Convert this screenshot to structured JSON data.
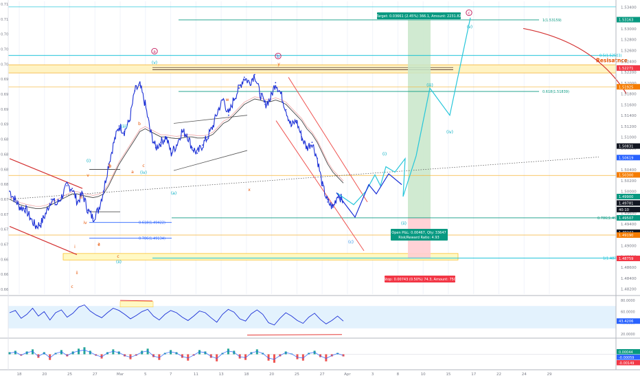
{
  "chart_data": {
    "type": "line",
    "instrument_note": "",
    "price_axis": {
      "ticks": [
        "1.53400",
        "1.53163",
        "1.53000",
        "1.52800",
        "1.52600",
        "1.52400",
        "1.52271",
        "1.52200",
        "1.52000",
        "1.51800",
        "1.51600",
        "1.51400",
        "1.51200",
        "1.51000",
        "1.50800",
        "1.50619",
        "1.50400",
        "1.50200",
        "1.50000",
        "1.49800",
        "1.49600",
        "1.49400",
        "1.49200",
        "1.49000",
        "1.48800",
        "1.48600",
        "1.48400",
        "1.48200",
        "1.48000",
        "1.47800"
      ],
      "ylim": [
        1.481,
        1.535
      ],
      "badges": [
        {
          "label": "1.53163",
          "value": 1.53163,
          "color": "#089981"
        },
        {
          "label": "1.52271",
          "value": 1.52271,
          "color": "#f23645"
        },
        {
          "label": "1.51925",
          "value": 1.51925,
          "color": "#f57c00"
        },
        {
          "label": "1.50831",
          "value": 1.50831,
          "color": "#131722"
        },
        {
          "label": "1.50619",
          "value": 1.50619,
          "color": "#2962ff"
        },
        {
          "label": "1.50300",
          "value": 1.503,
          "color": "#f57c00"
        },
        {
          "label": "1.49900",
          "value": 1.499,
          "color": "#089981"
        },
        {
          "label": "1.49781",
          "value": 1.49781,
          "color": "#131722"
        },
        {
          "label": "40:10",
          "value": 1.4966,
          "color": "#131722"
        },
        {
          "label": "1.49507",
          "value": 1.49507,
          "color": "#089981"
        },
        {
          "label": "1.49242",
          "value": 1.49242,
          "color": "#131722"
        },
        {
          "label": "1.49190",
          "value": 1.4919,
          "color": "#f57c00"
        },
        {
          "label": "1.48759",
          "value": 1.48759,
          "color": "#f23645"
        }
      ]
    },
    "left_axis_ticks": [
      "0.71",
      "0.71",
      "0.70",
      "0.70",
      "0.70",
      "0.69",
      "0.69",
      "0.69",
      "0.69",
      "0.68",
      "0.68",
      "0.68",
      "0.68",
      "0.67",
      "0.67",
      "0.67",
      "0.67",
      "0.66",
      "0.66",
      "0.66"
    ],
    "time_axis": [
      "18",
      "20",
      "25",
      "27",
      "Mar",
      "5",
      "7",
      "11",
      "13",
      "18",
      "20",
      "25",
      "27",
      "Apr",
      "3",
      "8",
      "10",
      "15",
      "17",
      "22",
      "24",
      "29"
    ],
    "price_series": [
      1.5,
      1.4985,
      1.497,
      1.4968,
      1.495,
      1.4935,
      1.494,
      1.496,
      1.4985,
      1.4975,
      1.499,
      1.501,
      1.5005,
      1.498,
      1.4995,
      1.4965,
      1.495,
      1.4965,
      1.5,
      1.505,
      1.509,
      1.512,
      1.511,
      1.513,
      1.5185,
      1.5195,
      1.516,
      1.511,
      1.508,
      1.509,
      1.51,
      1.507,
      1.5085,
      1.511,
      1.5105,
      1.508,
      1.507,
      1.5085,
      1.51,
      1.512,
      1.515,
      1.517,
      1.514,
      1.517,
      1.519,
      1.521,
      1.52,
      1.5215,
      1.518,
      1.516,
      1.517,
      1.52,
      1.518,
      1.515,
      1.512,
      1.513,
      1.51,
      1.508,
      1.509,
      1.506,
      1.501,
      1.498,
      1.497,
      1.4995,
      1.498
    ],
    "moving_average": [
      1.4985,
      1.498,
      1.4975,
      1.4972,
      1.497,
      1.4968,
      1.4968,
      1.497,
      1.4975,
      1.498,
      1.4985,
      1.499,
      1.4995,
      1.4995,
      1.4992,
      1.499,
      1.4988,
      1.499,
      1.4995,
      1.501,
      1.503,
      1.505,
      1.5065,
      1.508,
      1.5095,
      1.511,
      1.5115,
      1.511,
      1.5105,
      1.51,
      1.51,
      1.5098,
      1.5097,
      1.5098,
      1.51,
      1.51,
      1.5098,
      1.5098,
      1.51,
      1.5105,
      1.5115,
      1.5125,
      1.513,
      1.514,
      1.515,
      1.516,
      1.5165,
      1.517,
      1.5168,
      1.5165,
      1.5165,
      1.5168,
      1.5165,
      1.516,
      1.515,
      1.514,
      1.513,
      1.5115,
      1.5105,
      1.509,
      1.507,
      1.505,
      1.5035,
      1.5025,
      1.5015
    ],
    "projection_path": [
      1.4997,
      1.4975,
      1.5,
      1.503,
      1.501,
      1.5045,
      1.5035,
      1.506,
      1.499,
      1.5065,
      1.519,
      1.514,
      1.532
    ],
    "horizontal_levels": [
      {
        "label": "1(1.53159)",
        "value": 1.53159,
        "color": "#089981"
      },
      {
        "label": "0.5(1.52503)",
        "value": 1.52503,
        "color": "#00bcd4"
      },
      {
        "label": "0.618(1.51839)",
        "value": 1.51839,
        "color": "#089981"
      },
      {
        "label": "0.786(1.49508)",
        "value": 1.49508,
        "color": "#089981"
      },
      {
        "label": "1(1.48765)",
        "value": 1.48765,
        "color": "#00bcd4"
      },
      {
        "label": "0.618(1.49422)",
        "value": 1.49422,
        "color": "#2962ff"
      },
      {
        "label": "0.786(1.49134)",
        "value": 1.49134,
        "color": "#2962ff"
      }
    ],
    "resistance_label": "Resisatnce",
    "target_box": "Target: 0.03661 (2.45%) 366.1, Amount: 2231.82",
    "stop_box": "Stop: 0.00743 (0.50%) 74.3, Amount: 750",
    "open_pnl_line1": "Open P&L: 0.00467, Qty: 33647",
    "open_pnl_line2": "Risk/Reward Ratio: 4.93",
    "wave_labels": [
      {
        "text": "a",
        "color": "#c2185b",
        "circled": true
      },
      {
        "text": "b",
        "color": "#c2185b",
        "circled": true
      },
      {
        "text": "c",
        "color": "#c2185b",
        "circled": true
      },
      {
        "text": "b",
        "color": "#1e88e5",
        "circled": false,
        "paren": true
      },
      {
        "text": "(v)",
        "color": "#00acc1"
      },
      {
        "text": "(i)",
        "color": "#00acc1"
      },
      {
        "text": "(ii)",
        "color": "#00acc1"
      },
      {
        "text": "(iii)",
        "color": "#00acc1"
      },
      {
        "text": "(iv)",
        "color": "#00acc1"
      },
      {
        "text": "(a)",
        "color": "#00acc1"
      },
      {
        "text": "(c)",
        "color": "#1e88e5"
      },
      {
        "text": "(i)",
        "color": "#00acc1"
      },
      {
        "text": "(ii)",
        "color": "#00acc1"
      },
      {
        "text": "(iii)",
        "color": "#00acc1"
      },
      {
        "text": "(iv)",
        "color": "#00acc1"
      },
      {
        "text": "(v)",
        "color": "#00acc1"
      },
      {
        "text": "w",
        "color": "#e65100"
      },
      {
        "text": "x",
        "color": "#e65100"
      },
      {
        "text": "y",
        "color": "#e65100"
      },
      {
        "text": "b",
        "color": "#e65100"
      },
      {
        "text": "c",
        "color": "#e65100"
      },
      {
        "text": "a",
        "color": "#e65100"
      },
      {
        "text": "b",
        "color": "#e65100"
      },
      {
        "text": "c",
        "color": "#e65100"
      },
      {
        "text": "i",
        "color": "#e65100"
      },
      {
        "text": "ii",
        "color": "#e65100"
      },
      {
        "text": "iii",
        "color": "#e65100"
      },
      {
        "text": "iv",
        "color": "#e65100"
      },
      {
        "text": "v",
        "color": "#e65100"
      },
      {
        "text": "a",
        "color": "#e65100"
      },
      {
        "text": "b",
        "color": "#e65100"
      },
      {
        "text": "c",
        "color": "#e65100"
      },
      {
        "text": "c",
        "color": "#e65100"
      }
    ],
    "oscillator1": {
      "ticks": [
        "80.0000",
        "60.0000",
        "40.0000",
        "20.0000"
      ],
      "value_label": "43.4206",
      "ylim": [
        15,
        85
      ],
      "band": [
        30,
        70
      ],
      "values": [
        58,
        62,
        48,
        55,
        66,
        52,
        60,
        45,
        58,
        63,
        50,
        57,
        68,
        72,
        61,
        54,
        49,
        58,
        66,
        62,
        55,
        47,
        53,
        60,
        64,
        52,
        45,
        55,
        62,
        58,
        50,
        44,
        52,
        61,
        58,
        49,
        41,
        55,
        64,
        59,
        47,
        43,
        56,
        63,
        55,
        40,
        36,
        48,
        58,
        52,
        44,
        39,
        50,
        57,
        46,
        38,
        44,
        52,
        43
      ]
    },
    "oscillator2": {
      "value_label_1": "0.00044",
      "value_label_2": "-0.00059",
      "value_label_3": "-0.00149",
      "ylim": [
        -0.004,
        0.004
      ],
      "histogram": [
        0.0006,
        0.001,
        -0.0004,
        0.0008,
        0.0014,
        -0.001,
        0.0006,
        -0.0016,
        0.0004,
        0.0012,
        -0.0006,
        0.0008,
        0.0016,
        0.002,
        0.001,
        -0.0004,
        -0.0012,
        0.0006,
        0.0014,
        0.0008,
        -0.0006,
        -0.0014,
        -0.0004,
        0.001,
        0.0016,
        -0.0008,
        -0.0016,
        0.0004,
        0.0012,
        0.0006,
        -0.001,
        -0.0018,
        -0.0004,
        0.0012,
        0.0008,
        -0.001,
        -0.002,
        0.0004,
        0.0016,
        0.001,
        -0.0012,
        -0.0016,
        0.0006,
        0.0014,
        0.0004,
        -0.0018,
        -0.0024,
        -0.0006,
        0.0008,
        0.0002,
        -0.0014,
        -0.0018,
        0.0004,
        0.001,
        -0.0008,
        -0.002,
        -0.0006,
        0.0004,
        -0.0006
      ]
    }
  }
}
